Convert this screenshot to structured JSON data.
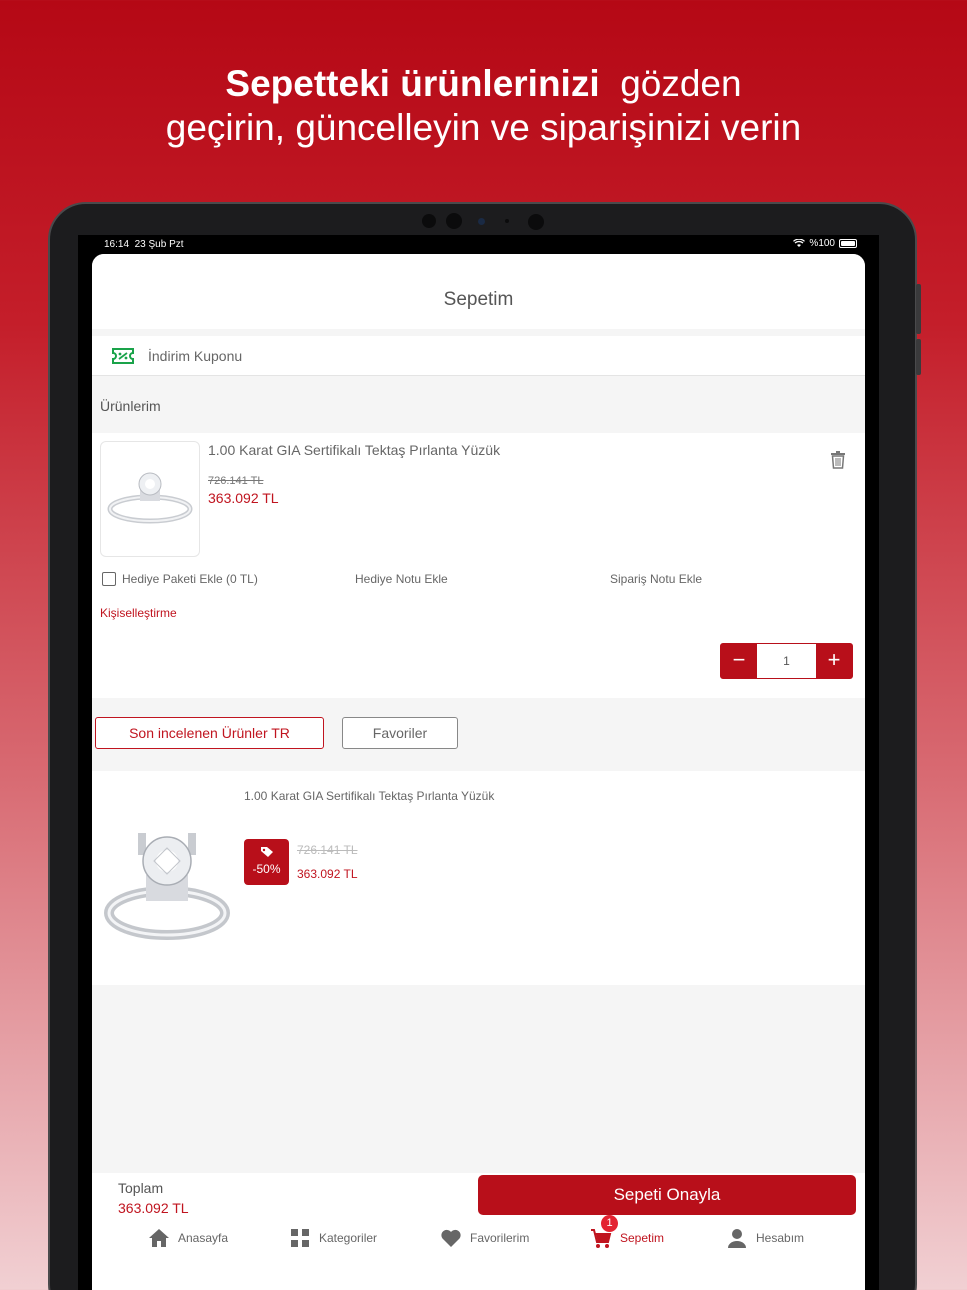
{
  "headline": {
    "bold": "Sepetteki ürünlerinizi",
    "rest_line1": "gözden",
    "line2": "geçirin, güncelleyin ve siparişinizi verin"
  },
  "status_bar": {
    "time": "16:14",
    "date": "23 Şub Pzt",
    "battery": "%100"
  },
  "page_title": "Sepetim",
  "coupon": {
    "label": "İndirim Kuponu",
    "icon": "coupon-icon"
  },
  "cart": {
    "section_label": "Ürünlerim",
    "item": {
      "title": "1.00 Karat GIA Sertifikalı Tektaş Pırlanta Yüzük",
      "old_price": "726.141 TL",
      "price": "363.092 TL",
      "gift_package": "Hediye Paketi Ekle (0 TL)",
      "gift_note": "Hediye Notu Ekle",
      "order_note": "Sipariş Notu Ekle",
      "personalize": "Kişiselleştirme",
      "quantity": "1",
      "minus": "−",
      "plus": "+"
    }
  },
  "tabs": {
    "recent": "Son incelenen Ürünler TR",
    "favorites": "Favoriler"
  },
  "recommendation": {
    "title": "1.00 Karat GIA Sertifikalı Tektaş Pırlanta Yüzük",
    "discount": "-50%",
    "old_price": "726.141 TL",
    "price": "363.092 TL"
  },
  "footer": {
    "total_label": "Toplam",
    "total_value": "363.092 TL",
    "confirm": "Sepeti Onayla"
  },
  "tabbar": {
    "home": "Anasayfa",
    "categories": "Kategoriler",
    "favorites": "Favorilerim",
    "cart": "Sepetim",
    "cart_badge": "1",
    "account": "Hesabım"
  },
  "colors": {
    "brand": "#b80f1a",
    "accent_red": "#c0141f",
    "coupon_green": "#1aa34a"
  }
}
